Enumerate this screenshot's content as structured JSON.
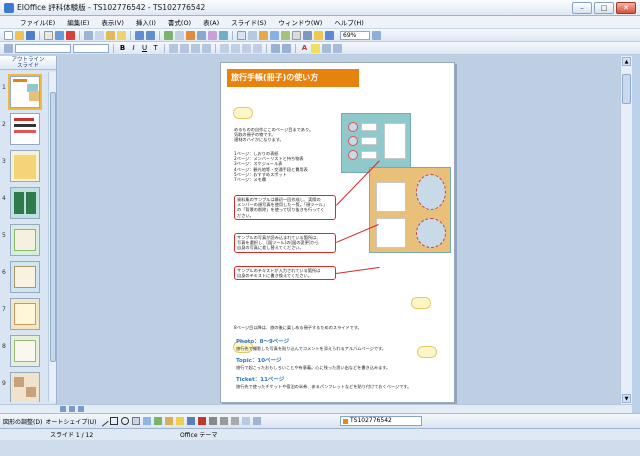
{
  "window": {
    "title": "EIOffice 評科体験版 - TS102776542 - TS102776542"
  },
  "menu": [
    "ファイル(E)",
    "編集(E)",
    "表示(V)",
    "挿入(I)",
    "書式(O)",
    "表(A)",
    "スライド(S)",
    "ウィンドウ(W)",
    "ヘルプ(H)"
  ],
  "toolbar": {
    "zoom": "69%"
  },
  "leftpane": {
    "tab_outline": "アウトライン",
    "tab_slide": "スライド"
  },
  "thumbnails": [
    "1",
    "2",
    "3",
    "4",
    "5",
    "6",
    "7",
    "8",
    "9"
  ],
  "slide": {
    "title": "旅行手帳(冊子)の使い方",
    "intro": "めるものの自作にこのページ目まであり。\n気取の冊子の物です。\n適材のハイかになります。",
    "pages": "1ページ：しおりの表紙\n2ページ：メンバーリストと持ち物表\n3ページ：スケジュール表\n4ページ：観光地等・交通手段と費用表\n5ページ：おすすめスポット\n7ページ：メモ欄",
    "callout1": "資料集のサンプルは最初一回作成し、実際の\nメンバーの顔写真を使用した一覧。「顔ツール」\nの「背景の削除」を使って切り抜きを行ってく\nださい。",
    "callout2": "サンプルの写真が読み込まれている箇所は、\n写真を選択し、[図ツール]の[図の変更]から\n自身の写真に差し替えてください。",
    "callout3": "サンプルのテキストが入力されている箇所は\n自身のテキストに書き換えてください。",
    "bottom_intro": "8ページ目以降は、旅の後に楽しめる冊子するためのスライドです。",
    "photo_head": "Photo：8～9ページ",
    "photo_text": "旅行先で撮影した写真を貼り込んでコメントを添えられるアルバムページです。",
    "topic_head": "Topic：10ページ",
    "topic_text": "旅行で起こったおもしろいことや有意義。心に残った思い出などを書き込みます。",
    "ticket_head": "Ticket：11ページ",
    "ticket_text": "旅行先で使ったチケットや宿泊の半券、あるパンフレットなどを貼り付けておくページです。"
  },
  "drawbar": {
    "arrange": "図形の調整(D)",
    "autoshape": "オートシェイプ(U)",
    "file_tab": "TS102776542"
  },
  "status": {
    "slide_count": "スライド 1 / 12",
    "theme": "Office テーマ"
  },
  "colors": {
    "title_bg": "#e8820f",
    "accent_red": "#d42a2a",
    "section_blue": "#2f76b8"
  }
}
